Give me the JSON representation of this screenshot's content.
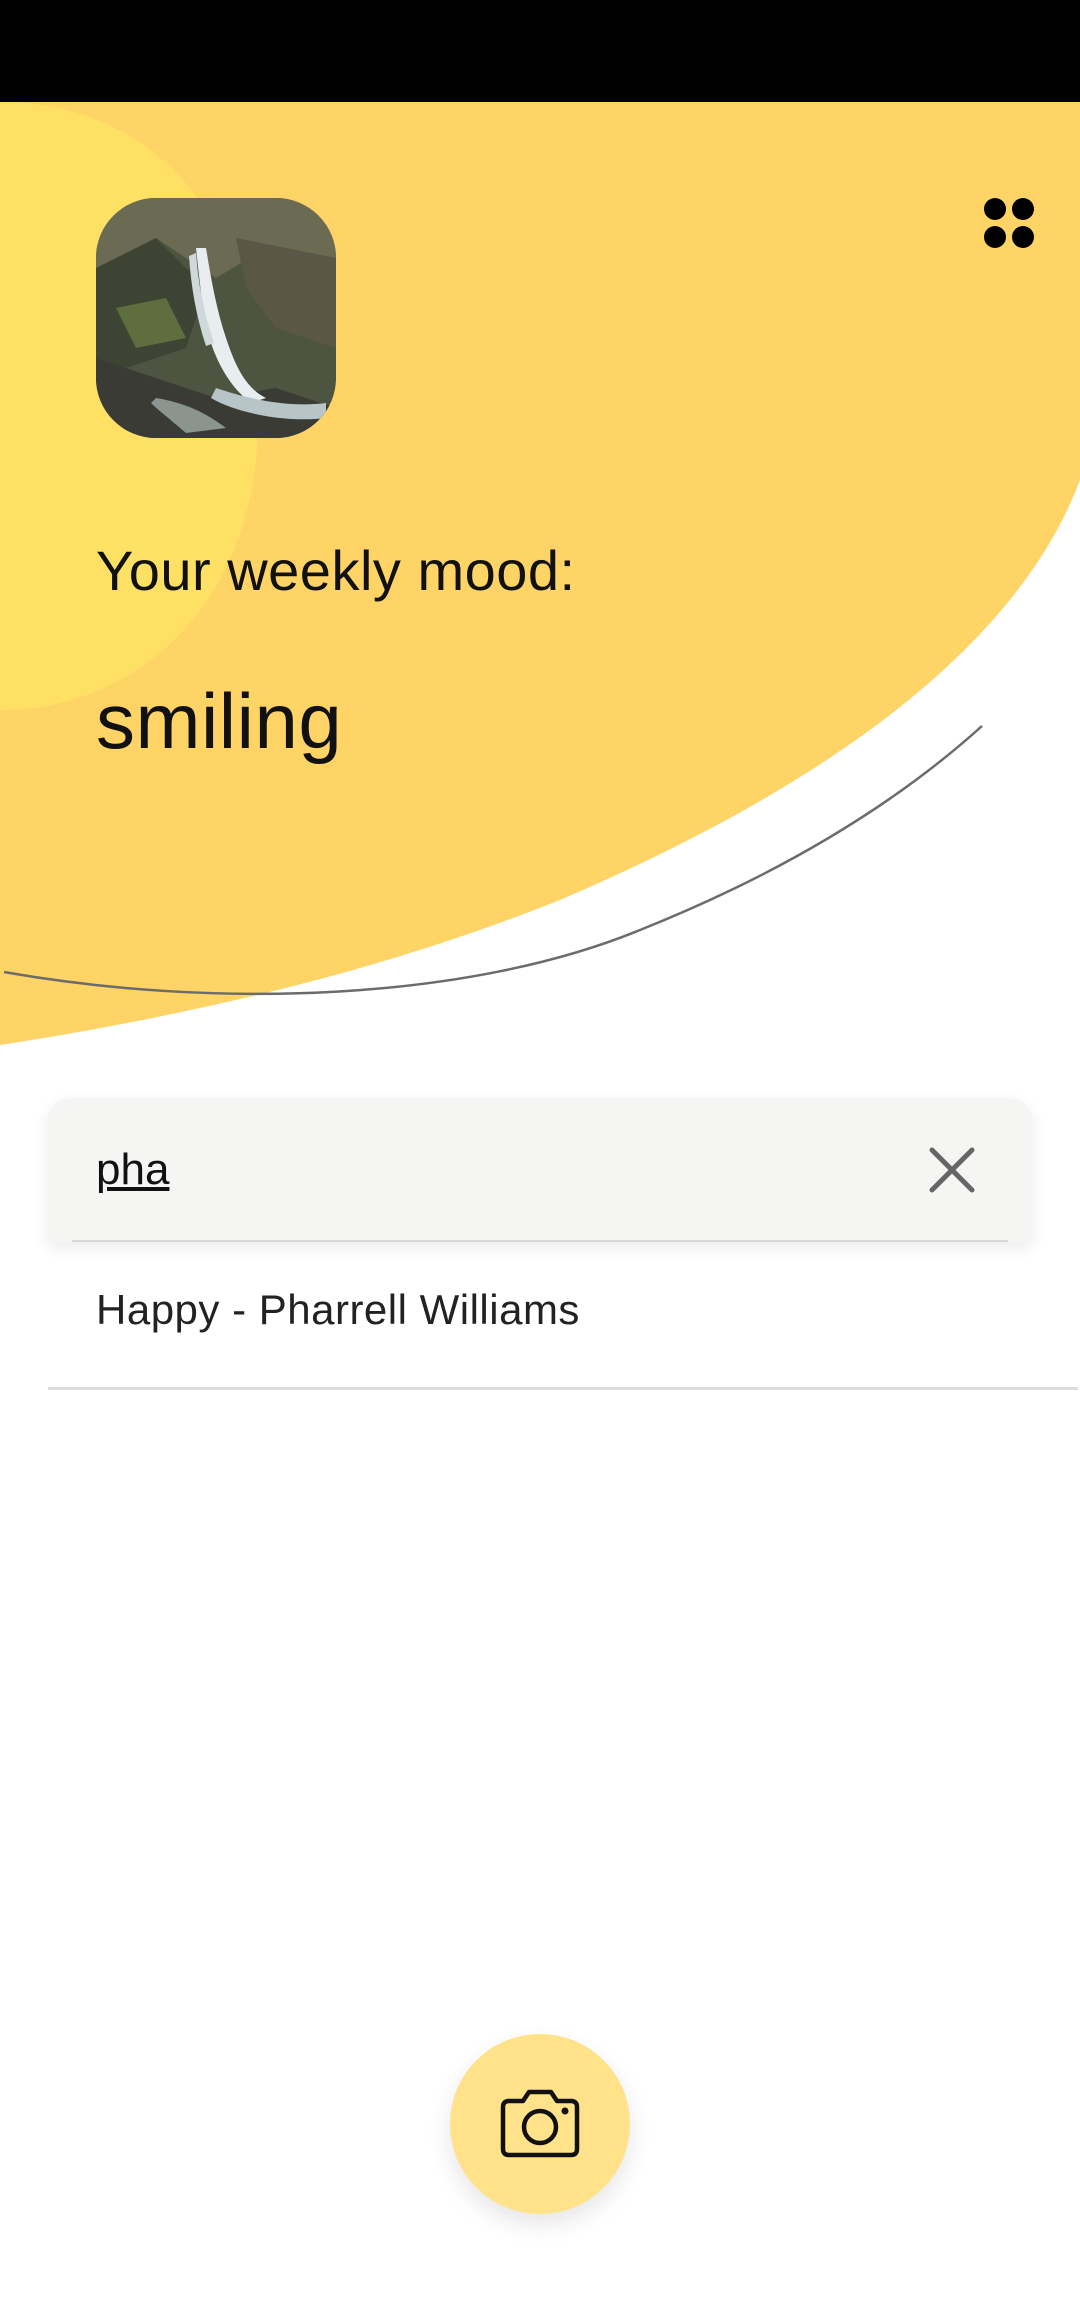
{
  "header": {
    "weekly_label": "Your weekly mood:",
    "mood": "smiling",
    "menu_icon": "grid-dots-icon",
    "avatar_icon": "waterfall-photo",
    "colors": {
      "primary_yellow": "#fed466",
      "light_yellow": "#fee064",
      "arc_line": "#6b6b6b"
    }
  },
  "search": {
    "value": "pha",
    "placeholder": "",
    "clear_icon": "close-icon"
  },
  "results": [
    {
      "label": "Happy - Pharrell Williams"
    }
  ],
  "fab": {
    "icon": "camera-icon",
    "color": "#ffe28a"
  }
}
